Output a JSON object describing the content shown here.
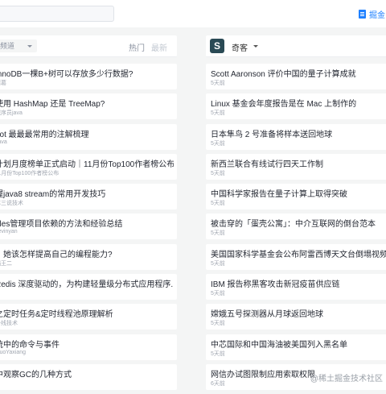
{
  "topbar": {
    "search_placeholder": "",
    "link_label": "掘金"
  },
  "left": {
    "select_label": "频道",
    "tabs": {
      "hot": "热门",
      "newest": "最新"
    },
    "items": [
      {
        "title": "InnoDB一棵B+树可以存放多少行数据?",
        "meta": "诸葛",
        "clip": 4
      },
      {
        "title": "使用 HashMap 还是 TreeMap?",
        "meta": "程序员java",
        "clip": 0
      },
      {
        "title": "oot 最最最常用的注解梳理",
        "meta": "Java",
        "clip": 0
      },
      {
        "title": "计划月度榜单正式启动｜11月份Top100作者榜公布",
        "meta": "11月份Top100作者榜公布",
        "clip": 0
      },
      {
        "title": "握java8 stream的常用开发技巧",
        "meta": "苏三说技术",
        "clip": 0
      },
      {
        "title": "ales管理项目依赖的方法和经验总结",
        "meta": "kevinyan",
        "clip": 0
      },
      {
        "title": "，她该怎样提高自己的编程能力?",
        "meta": "蜗王二",
        "clip": 0
      },
      {
        "title": "Redis 深度驱动的，为构建轻量级分布式应用程序...",
        "meta": "",
        "clip": 0
      },
      {
        "title": "之定时任务&定时线程池原理解析",
        "meta": "一线技术",
        "clip": 0
      },
      {
        "title": "统中的命令与事件",
        "meta": "GuoYaxiang",
        "clip": 0
      },
      {
        "title": "中观察GC的几种方式",
        "meta": "",
        "clip": 0
      }
    ]
  },
  "right": {
    "source_logo": "S",
    "source_name": "奇客",
    "items": [
      {
        "title": "Scott Aaronson 评价中国的量子计算成就",
        "meta": "5天前"
      },
      {
        "title": "Linux 基金会年度报告是在 Mac 上制作的",
        "meta": "5天前"
      },
      {
        "title": "日本隼鸟 2 号准备将样本送回地球",
        "meta": "5天前"
      },
      {
        "title": "新西兰联合有线试行四天工作制",
        "meta": "5天前"
      },
      {
        "title": "中国科学家报告在量子计算上取得突破",
        "meta": "5天前"
      },
      {
        "title": "被击穿的「蛋壳公寓」：中介互联网的倒台范本",
        "meta": "5天前"
      },
      {
        "title": "美国国家科学基金会公布阿雷西博天文台倒塌视频",
        "meta": "5天前"
      },
      {
        "title": "IBM 报告称黑客攻击新冠疫苗供应链",
        "meta": "5天前"
      },
      {
        "title": "嫦娥五号探测器从月球返回地球",
        "meta": "5天前"
      },
      {
        "title": "中芯国际和中国海油被美国列入黑名单",
        "meta": "5天前"
      },
      {
        "title": "网信办试图限制应用索取权限",
        "meta": "6天前"
      }
    ]
  },
  "watermark": "@稀土掘金技术社区"
}
